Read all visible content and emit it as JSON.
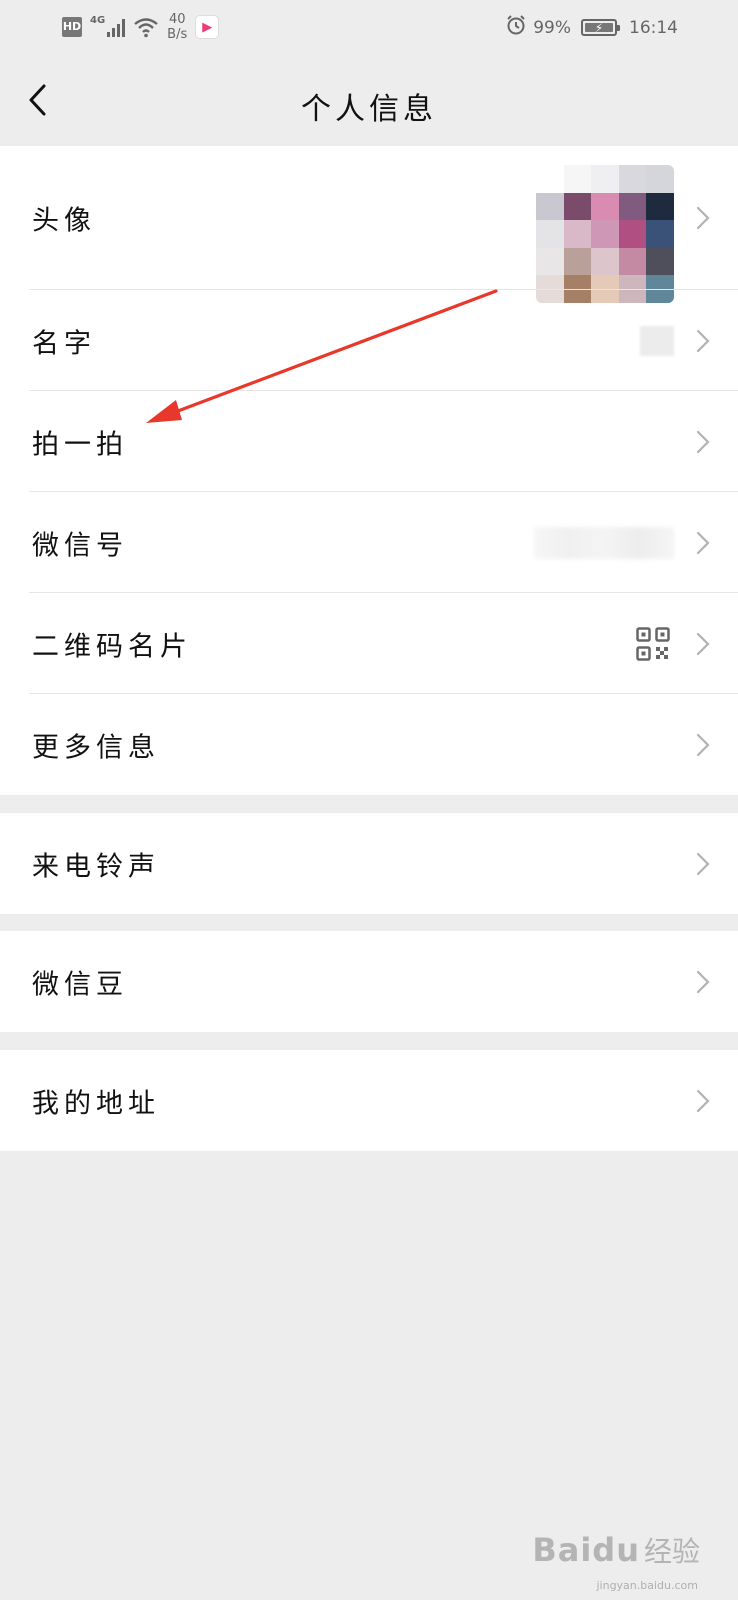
{
  "status_bar": {
    "hd": "HD",
    "network": "4G",
    "speed_value": "40",
    "speed_unit": "B/s",
    "battery_percent": "99%",
    "battery_level": 0.99,
    "time": "16:14",
    "icons": [
      "hd-icon",
      "signal-icon",
      "wifi-icon",
      "youku-app-icon",
      "alarm-icon",
      "battery-icon"
    ]
  },
  "header": {
    "title": "个人信息",
    "back_icon": "chevron-left-icon"
  },
  "groups": [
    {
      "rows": [
        {
          "label": "头像",
          "accessory": "avatar-image"
        },
        {
          "label": "名字",
          "accessory": "blurred-name"
        },
        {
          "label": "拍一拍",
          "accessory": ""
        },
        {
          "label": "微信号",
          "accessory": "blurred-wechat-id"
        },
        {
          "label": "二维码名片",
          "accessory": "qr-code-icon"
        },
        {
          "label": "更多信息",
          "accessory": ""
        }
      ]
    },
    {
      "rows": [
        {
          "label": "来电铃声"
        }
      ]
    },
    {
      "rows": [
        {
          "label": "微信豆"
        }
      ]
    },
    {
      "rows": [
        {
          "label": "我的地址"
        }
      ]
    }
  ],
  "annotation": {
    "type": "red-arrow",
    "color": "#e8372b",
    "points_to": "拍一拍"
  },
  "watermark": {
    "brand": "Baidu",
    "sub": "经验",
    "url": "jingyan.baidu.com"
  },
  "colors": {
    "background": "#ededed",
    "card": "#ffffff",
    "divider": "#e6e6e6",
    "chevron": "#b2b2b2",
    "text": "#111111"
  }
}
